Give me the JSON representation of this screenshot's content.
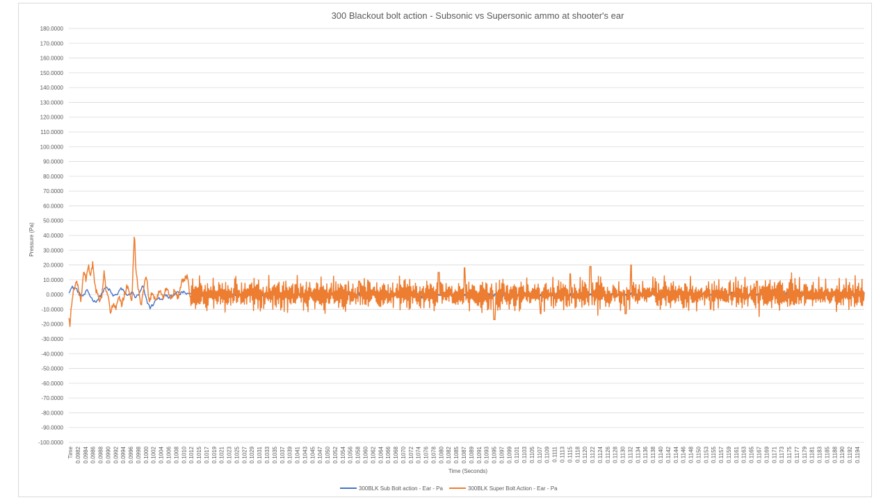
{
  "chart_data": {
    "type": "line",
    "title": "300 Blackout bolt action  - Subsonic vs Supersonic ammo at shooter's ear",
    "xlabel": "Time (Seconds)",
    "ylabel": "Pressure (Pa)",
    "ylim": [
      -100,
      180
    ],
    "yticks": [
      180,
      170,
      160,
      150,
      140,
      130,
      120,
      110,
      100,
      90,
      80,
      70,
      60,
      50,
      40,
      30,
      20,
      10,
      0,
      -10,
      -20,
      -30,
      -40,
      -50,
      -60,
      -70,
      -80,
      -90,
      -100
    ],
    "ytick_labels": [
      "180.0000",
      "170.0000",
      "160.0000",
      "150.0000",
      "140.0000",
      "130.0000",
      "120.0000",
      "110.0000",
      "100.0000",
      "90.0000",
      "80.0000",
      "70.0000",
      "60.0000",
      "50.0000",
      "40.0000",
      "30.0000",
      "20.0000",
      "10.0000",
      "0.0000",
      "-10.0000",
      "-20.0000",
      "-30.0000",
      "-40.0000",
      "-50.0000",
      "-60.0000",
      "-70.0000",
      "-80.0000",
      "-90.0000",
      "-100.0000"
    ],
    "xtick_labels": [
      "Time",
      "0.0982",
      "0.0984",
      "0.0986",
      "0.0988",
      "0.0990",
      "0.0992",
      "0.0994",
      "0.0996",
      "0.0998",
      "0.1000",
      "0.1002",
      "0.1004",
      "0.1006",
      "0.1008",
      "0.1010",
      "0.1012",
      "0.1015",
      "0.1017",
      "0.1019",
      "0.1021",
      "0.1023",
      "0.1025",
      "0.1027",
      "0.1029",
      "0.1031",
      "0.1033",
      "0.1035",
      "0.1037",
      "0.1039",
      "0.1041",
      "0.1043",
      "0.1045",
      "0.1047",
      "0.1050",
      "0.1052",
      "0.1054",
      "0.1056",
      "0.1058",
      "0.1060",
      "0.1062",
      "0.1064",
      "0.1066",
      "0.1068",
      "0.1070",
      "0.1072",
      "0.1074",
      "0.1076",
      "0.1078",
      "0.1080",
      "0.1082",
      "0.1085",
      "0.1087",
      "0.1089",
      "0.1091",
      "0.1093",
      "0.1095",
      "0.1097",
      "0.1099",
      "0.1101",
      "0.1103",
      "0.1105",
      "0.1107",
      "0.1109",
      "0.1111",
      "0.1113",
      "0.1115",
      "0.1118",
      "0.1120",
      "0.1122",
      "0.1124",
      "0.1126",
      "0.1128",
      "0.1130",
      "0.1132",
      "0.1134",
      "0.1136",
      "0.1138",
      "0.1140",
      "0.1142",
      "0.1144",
      "0.1146",
      "0.1148",
      "0.1150",
      "0.1153",
      "0.1155",
      "0.1157",
      "0.1159",
      "0.1161",
      "0.1163",
      "0.1165",
      "0.1167",
      "0.1169",
      "0.1171",
      "0.1173",
      "0.1175",
      "0.1177",
      "0.1179",
      "0.1181",
      "0.1183",
      "0.1185",
      "0.1188",
      "0.1190",
      "0.1192",
      "0.1194"
    ],
    "grid": true,
    "legend_position": "bottom",
    "series": [
      {
        "name": "300BLK Sub Bolt action - Ear - Pa",
        "color": "#4472c4",
        "x_start": 0.09805,
        "x_end": 0.11955,
        "keypoints": [
          [
            0.09805,
            2
          ],
          [
            0.09815,
            5
          ],
          [
            0.09825,
            4
          ],
          [
            0.09835,
            0
          ],
          [
            0.09845,
            -1
          ],
          [
            0.09855,
            3
          ],
          [
            0.09865,
            -2
          ],
          [
            0.09875,
            -5
          ],
          [
            0.09885,
            -3
          ],
          [
            0.09895,
            1
          ],
          [
            0.09905,
            5
          ],
          [
            0.09915,
            3
          ],
          [
            0.09925,
            -1
          ],
          [
            0.09935,
            0
          ],
          [
            0.09945,
            4
          ],
          [
            0.09955,
            2
          ],
          [
            0.09965,
            -1
          ],
          [
            0.09975,
            2
          ],
          [
            0.09985,
            -2
          ],
          [
            0.09995,
            0
          ],
          [
            0.10005,
            6
          ],
          [
            0.10015,
            -4
          ],
          [
            0.10025,
            -9
          ],
          [
            0.10035,
            -6
          ],
          [
            0.10045,
            -2
          ],
          [
            0.10055,
            -4
          ],
          [
            0.10065,
            0
          ],
          [
            0.10075,
            -2
          ],
          [
            0.10085,
            -1
          ],
          [
            0.10095,
            2
          ],
          [
            0.10105,
            0
          ],
          [
            0.10115,
            2
          ],
          [
            0.10125,
            0
          ],
          [
            0.10135,
            1
          ],
          [
            0.10145,
            1
          ],
          [
            0.10155,
            -1
          ],
          [
            0.10165,
            0
          ]
        ],
        "noise_amplitude": 1.5,
        "tail_amplitude": 2.0
      },
      {
        "name": "300BLK Super Bolt Action - Ear - Pa",
        "color": "#ed7d31",
        "x_start": 0.09805,
        "x_end": 0.11955,
        "keypoints": [
          [
            0.09805,
            -16
          ],
          [
            0.09808,
            -20
          ],
          [
            0.09812,
            -8
          ],
          [
            0.09818,
            3
          ],
          [
            0.09825,
            10
          ],
          [
            0.09832,
            2
          ],
          [
            0.09838,
            -5
          ],
          [
            0.09845,
            15
          ],
          [
            0.09852,
            10
          ],
          [
            0.09858,
            19
          ],
          [
            0.09864,
            14
          ],
          [
            0.0987,
            21
          ],
          [
            0.09876,
            5
          ],
          [
            0.09882,
            0
          ],
          [
            0.09888,
            -4
          ],
          [
            0.09894,
            -2
          ],
          [
            0.099,
            15
          ],
          [
            0.09906,
            2
          ],
          [
            0.09912,
            -3
          ],
          [
            0.09918,
            -12
          ],
          [
            0.09925,
            -6
          ],
          [
            0.09932,
            -10
          ],
          [
            0.0994,
            -2
          ],
          [
            0.09948,
            -7
          ],
          [
            0.09955,
            0
          ],
          [
            0.09962,
            5
          ],
          [
            0.09968,
            2
          ],
          [
            0.09975,
            -6
          ],
          [
            0.09982,
            42
          ],
          [
            0.09986,
            18
          ],
          [
            0.0999,
            8
          ],
          [
            0.09995,
            0
          ],
          [
            0.1,
            -8
          ],
          [
            0.10008,
            5
          ],
          [
            0.10015,
            12
          ],
          [
            0.10022,
            -6
          ],
          [
            0.1003,
            2
          ],
          [
            0.1004,
            -4
          ],
          [
            0.1005,
            3
          ],
          [
            0.1006,
            -2
          ],
          [
            0.1007,
            5
          ],
          [
            0.1008,
            -3
          ],
          [
            0.1009,
            2
          ],
          [
            0.101,
            -2
          ],
          [
            0.1011,
            8
          ],
          [
            0.10125,
            12
          ],
          [
            0.10135,
            -4
          ]
        ],
        "burst_events": [
          [
            0.1059,
            9
          ],
          [
            0.10805,
            15
          ],
          [
            0.10875,
            18
          ],
          [
            0.10955,
            -17
          ],
          [
            0.1108,
            -13
          ],
          [
            0.1116,
            14
          ],
          [
            0.11215,
            19
          ],
          [
            0.1131,
            -13
          ],
          [
            0.11325,
            20
          ],
          [
            0.1154,
            -10
          ],
          [
            0.11665,
            9
          ]
        ],
        "tail_amplitude": 7.5
      }
    ]
  }
}
